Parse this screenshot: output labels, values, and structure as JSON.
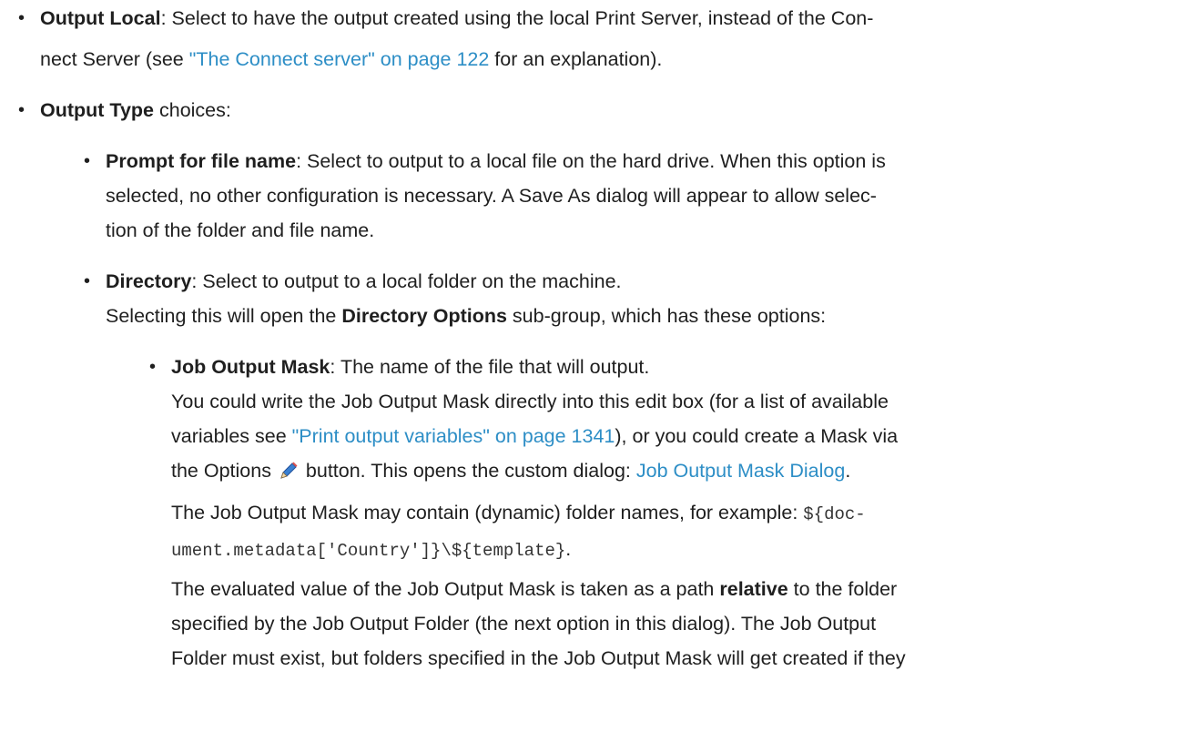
{
  "items": {
    "output_local": {
      "term": "Output Local",
      "text_a": ": Select to have the output created using the local Print Server, instead of the Con-",
      "text_b": "nect Server (see ",
      "link": "\"The Connect server\" on page 122",
      "text_c": " for an explanation)."
    },
    "output_type": {
      "term": "Output Type",
      "text": " choices:"
    },
    "prompt": {
      "term": "Prompt for file name",
      "line1": ": Select to output to a local file on the hard drive. When this option is",
      "line2": "selected, no other configuration is necessary. A Save As dialog will appear to allow selec-",
      "line3": "tion of the folder and file name."
    },
    "directory": {
      "term": "Directory",
      "line1": ": Select to output to a local folder on the machine.",
      "line2a": "Selecting this will open the ",
      "line2b": "Directory Options",
      "line2c": " sub-group, which has these options:"
    },
    "job_mask": {
      "term": "Job Output Mask",
      "line1": ": The name of the file that will output.",
      "line2": "You could write the Job Output Mask directly into this edit box (for a list of available",
      "line3a": "variables see ",
      "line3_link": "\"Print output variables\" on page 1341",
      "line3b": "), or you could create a Mask via",
      "line4a": "the Options ",
      "line4b": " button. This opens the custom dialog: ",
      "line4_link": "Job Output Mask Dialog",
      "line4c": ".",
      "line5a": "The Job Output Mask may contain (dynamic) folder names, for example: ",
      "line5_code": "${doc-",
      "line6_code": "ument.metadata['Country']}\\${template}",
      "line6b": ".",
      "line7a": "The evaluated value of the Job Output Mask is taken as a path ",
      "line7_bold": "relative",
      "line7b": " to the folder",
      "line8": "specified by the Job Output Folder (the next option in this dialog). The Job Output",
      "line9": "Folder must exist, but folders specified in the Job Output Mask will get created if they"
    }
  },
  "icons": {
    "bullet": "bullet-dot",
    "options": "pencil-icon"
  },
  "colors": {
    "link": "#2d8ec6",
    "text": "#1f1f1f"
  }
}
